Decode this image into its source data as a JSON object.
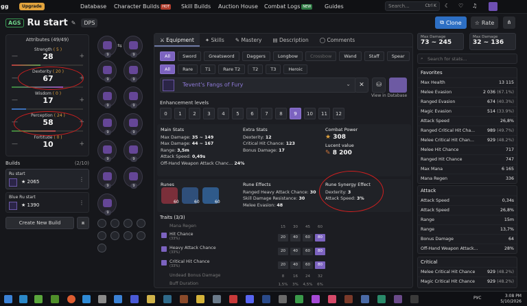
{
  "topbar": {
    "logo": "gg",
    "upgrade": "Upgrade",
    "nav": [
      "Database",
      "Character Builds",
      "Skill Builds",
      "Auction House",
      "Combat Logs",
      "Guides"
    ],
    "hot": "HOT",
    "new": "NEW",
    "search_placeholder": "Search...",
    "search_kbd": "Ctrl K"
  },
  "header": {
    "tag": "AGS",
    "title": "Ru start",
    "dps": "DPS",
    "clone": "Clone",
    "rate": "Rate"
  },
  "attributes": {
    "title": "Attributes (49/49)",
    "items": [
      {
        "label": "Strength",
        "bonus": "( 5 )",
        "value": "28"
      },
      {
        "label": "Dexterity",
        "bonus": "( 20 )",
        "value": "67"
      },
      {
        "label": "Wisdom",
        "bonus": "( 0 )",
        "value": "17"
      },
      {
        "label": "Perception",
        "bonus": "( 24 )",
        "value": "58"
      },
      {
        "label": "Fortitude",
        "bonus": "( 0 )",
        "value": "10"
      }
    ]
  },
  "builds": {
    "label": "Builds",
    "count": "(2/10)",
    "items": [
      {
        "name": "Ru start",
        "score": "2065"
      },
      {
        "name": "Blue Ru start",
        "score": "1390"
      }
    ],
    "create": "Create New Build"
  },
  "gear_level": "9",
  "tabs": [
    "Equipment",
    "Skills",
    "Mastery",
    "Description",
    "Comments"
  ],
  "weapon_filters": [
    "All",
    "Sword",
    "Greatsword",
    "Daggers",
    "Longbow",
    "Crossbow",
    "Wand",
    "Staff",
    "Spear"
  ],
  "rarity_filters": [
    "All",
    "Rare",
    "T1",
    "Rare T2",
    "T2",
    "T3",
    "Heroic"
  ],
  "weapon": {
    "name": "Tevent's Fangs of Fury",
    "view": "View in Database"
  },
  "enhancement": {
    "label": "Enhancement levels",
    "levels": [
      "0",
      "1",
      "2",
      "3",
      "4",
      "5",
      "6",
      "7",
      "8",
      "9",
      "10",
      "11",
      "12"
    ],
    "selected": "9"
  },
  "main_stats": {
    "title": "Main Stats",
    "rows": [
      [
        "Max Damage: ",
        "35 ~ 149"
      ],
      [
        "Max Damage: ",
        "44 ~ 167"
      ],
      [
        "Range: ",
        "3,5m"
      ],
      [
        "Attack Speed: ",
        "0,49s"
      ],
      [
        "Off-Hand Weapon Attack Chanc... ",
        "24%"
      ]
    ]
  },
  "extra_stats": {
    "title": "Extra Stats",
    "rows": [
      [
        "Dexterity: ",
        "12"
      ],
      [
        "Critical Hit Chance: ",
        "123"
      ],
      [
        "Bonus Damage: ",
        "17"
      ]
    ]
  },
  "combat_power": {
    "title": "Combat Power",
    "value": "308",
    "lucent_label": "Lucent value",
    "lucent": "8 200"
  },
  "runes": {
    "title": "Runes",
    "levels": [
      "60",
      "60",
      "60"
    ]
  },
  "rune_effects": {
    "title": "Rune Effects",
    "rows": [
      [
        "Ranged Heavy Attack Chance: ",
        "30"
      ],
      [
        "Skill Damage Resistance: ",
        "30"
      ],
      [
        "Melee Evasion: ",
        "48"
      ]
    ]
  },
  "rune_synergy": {
    "title": "Rune Synergy Effect",
    "rows": [
      [
        "Dexterity: ",
        "3"
      ],
      [
        "Attack Speed: ",
        "3%"
      ]
    ]
  },
  "traits": {
    "title": "Traits (3/3)",
    "rows": [
      {
        "name": "Mana Regen",
        "sub": "",
        "vals": [
          "15",
          "30",
          "45",
          "60"
        ],
        "active": false
      },
      {
        "name": "Hit Chance",
        "sub": "(33%)",
        "vals": [
          "20",
          "40",
          "60",
          "80"
        ],
        "active": true
      },
      {
        "name": "Heavy Attack Chance",
        "sub": "(33%)",
        "vals": [
          "20",
          "40",
          "60",
          "80"
        ],
        "active": true
      },
      {
        "name": "Critical Hit Chance",
        "sub": "(33%)",
        "vals": [
          "20",
          "40",
          "60",
          "80"
        ],
        "active": true
      },
      {
        "name": "Undead Bonus Damage",
        "sub": "",
        "vals": [
          "8",
          "16",
          "24",
          "32"
        ],
        "active": false
      },
      {
        "name": "Buff Duration",
        "sub": "",
        "vals": [
          "1,5%",
          "3%",
          "4,5%",
          "6%"
        ],
        "active": false
      }
    ]
  },
  "summary": {
    "max_damage_label": "Max Damage",
    "max_damage": "73 ~ 245",
    "max_damage2_label": "Max Damage",
    "max_damage2": "32 ~ 136",
    "search_placeholder": "Search for stats..."
  },
  "favorites": {
    "title": "Favorites",
    "rows": [
      [
        "Max Health",
        "13 115",
        ""
      ],
      [
        "Melee Evasion",
        "2 036",
        "(67.1%)"
      ],
      [
        "Ranged Evasion",
        "674",
        "(40.3%)"
      ],
      [
        "Magic Evasion",
        "514",
        "(33.9%)"
      ],
      [
        "Attack Speed",
        "26,8%",
        ""
      ],
      [
        "Ranged Critical Hit Cha...",
        "989",
        "(49.7%)"
      ],
      [
        "Melee Critical Hit Chan...",
        "929",
        "(48.2%)"
      ],
      [
        "Melee Hit Chance",
        "717",
        ""
      ],
      [
        "Ranged Hit Chance",
        "747",
        ""
      ],
      [
        "Max Mana",
        "6 165",
        ""
      ],
      [
        "Mana Regen",
        "336",
        ""
      ]
    ]
  },
  "attack": {
    "title": "Attack",
    "rows": [
      [
        "Attack Speed",
        "0,34s",
        ""
      ],
      [
        "Attack Speed",
        "26,8%",
        ""
      ],
      [
        "Range",
        "15m",
        ""
      ],
      [
        "Range",
        "13,7%",
        ""
      ],
      [
        "Bonus Damage",
        "64",
        ""
      ],
      [
        "Off-Hand Weapon Attack...",
        "28%",
        ""
      ]
    ]
  },
  "critical": {
    "title": "Critical",
    "rows": [
      [
        "Melee Critical Hit Chance",
        "929",
        "(48.2%)"
      ],
      [
        "Magic Critical Hit Chance",
        "929",
        "(48.2%)"
      ]
    ]
  },
  "clock": {
    "time": "3:08 PM",
    "date": "5/10/2026",
    "lang": "РУС"
  }
}
